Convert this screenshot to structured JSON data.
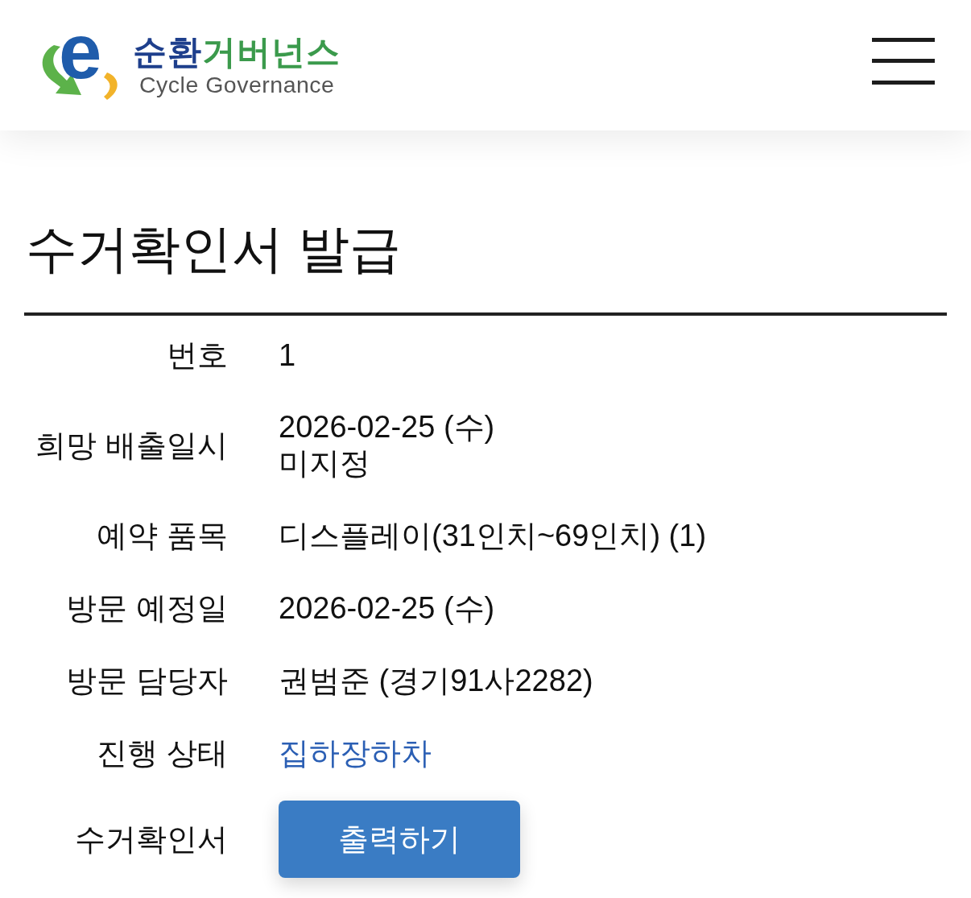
{
  "header": {
    "logo": {
      "mark": "e",
      "title": [
        {
          "text": "순환",
          "color": "#1e3f8c"
        },
        {
          "text": "거버넌스",
          "color": "#3b9a4c"
        }
      ],
      "subtitle": "Cycle Governance"
    }
  },
  "page": {
    "title": "수거확인서 발급"
  },
  "details": [
    {
      "kind": "text",
      "label": "번호",
      "lines": [
        "1"
      ]
    },
    {
      "kind": "text",
      "label": "희망 배출일시",
      "lines": [
        "2026-02-25 (수)",
        "미지정"
      ]
    },
    {
      "kind": "text",
      "label": "예약 품목",
      "lines": [
        "디스플레이(31인치~69인치) (1)"
      ]
    },
    {
      "kind": "text",
      "label": "방문 예정일",
      "lines": [
        "2026-02-25 (수)"
      ]
    },
    {
      "kind": "text",
      "label": "방문 담당자",
      "lines": [
        "권범준 (경기91사2282)"
      ]
    },
    {
      "kind": "status",
      "label": "진행 상태",
      "lines": [
        "집하장하차"
      ]
    },
    {
      "kind": "button",
      "label": "수거확인서",
      "lines": [
        "출력하기"
      ]
    }
  ]
}
